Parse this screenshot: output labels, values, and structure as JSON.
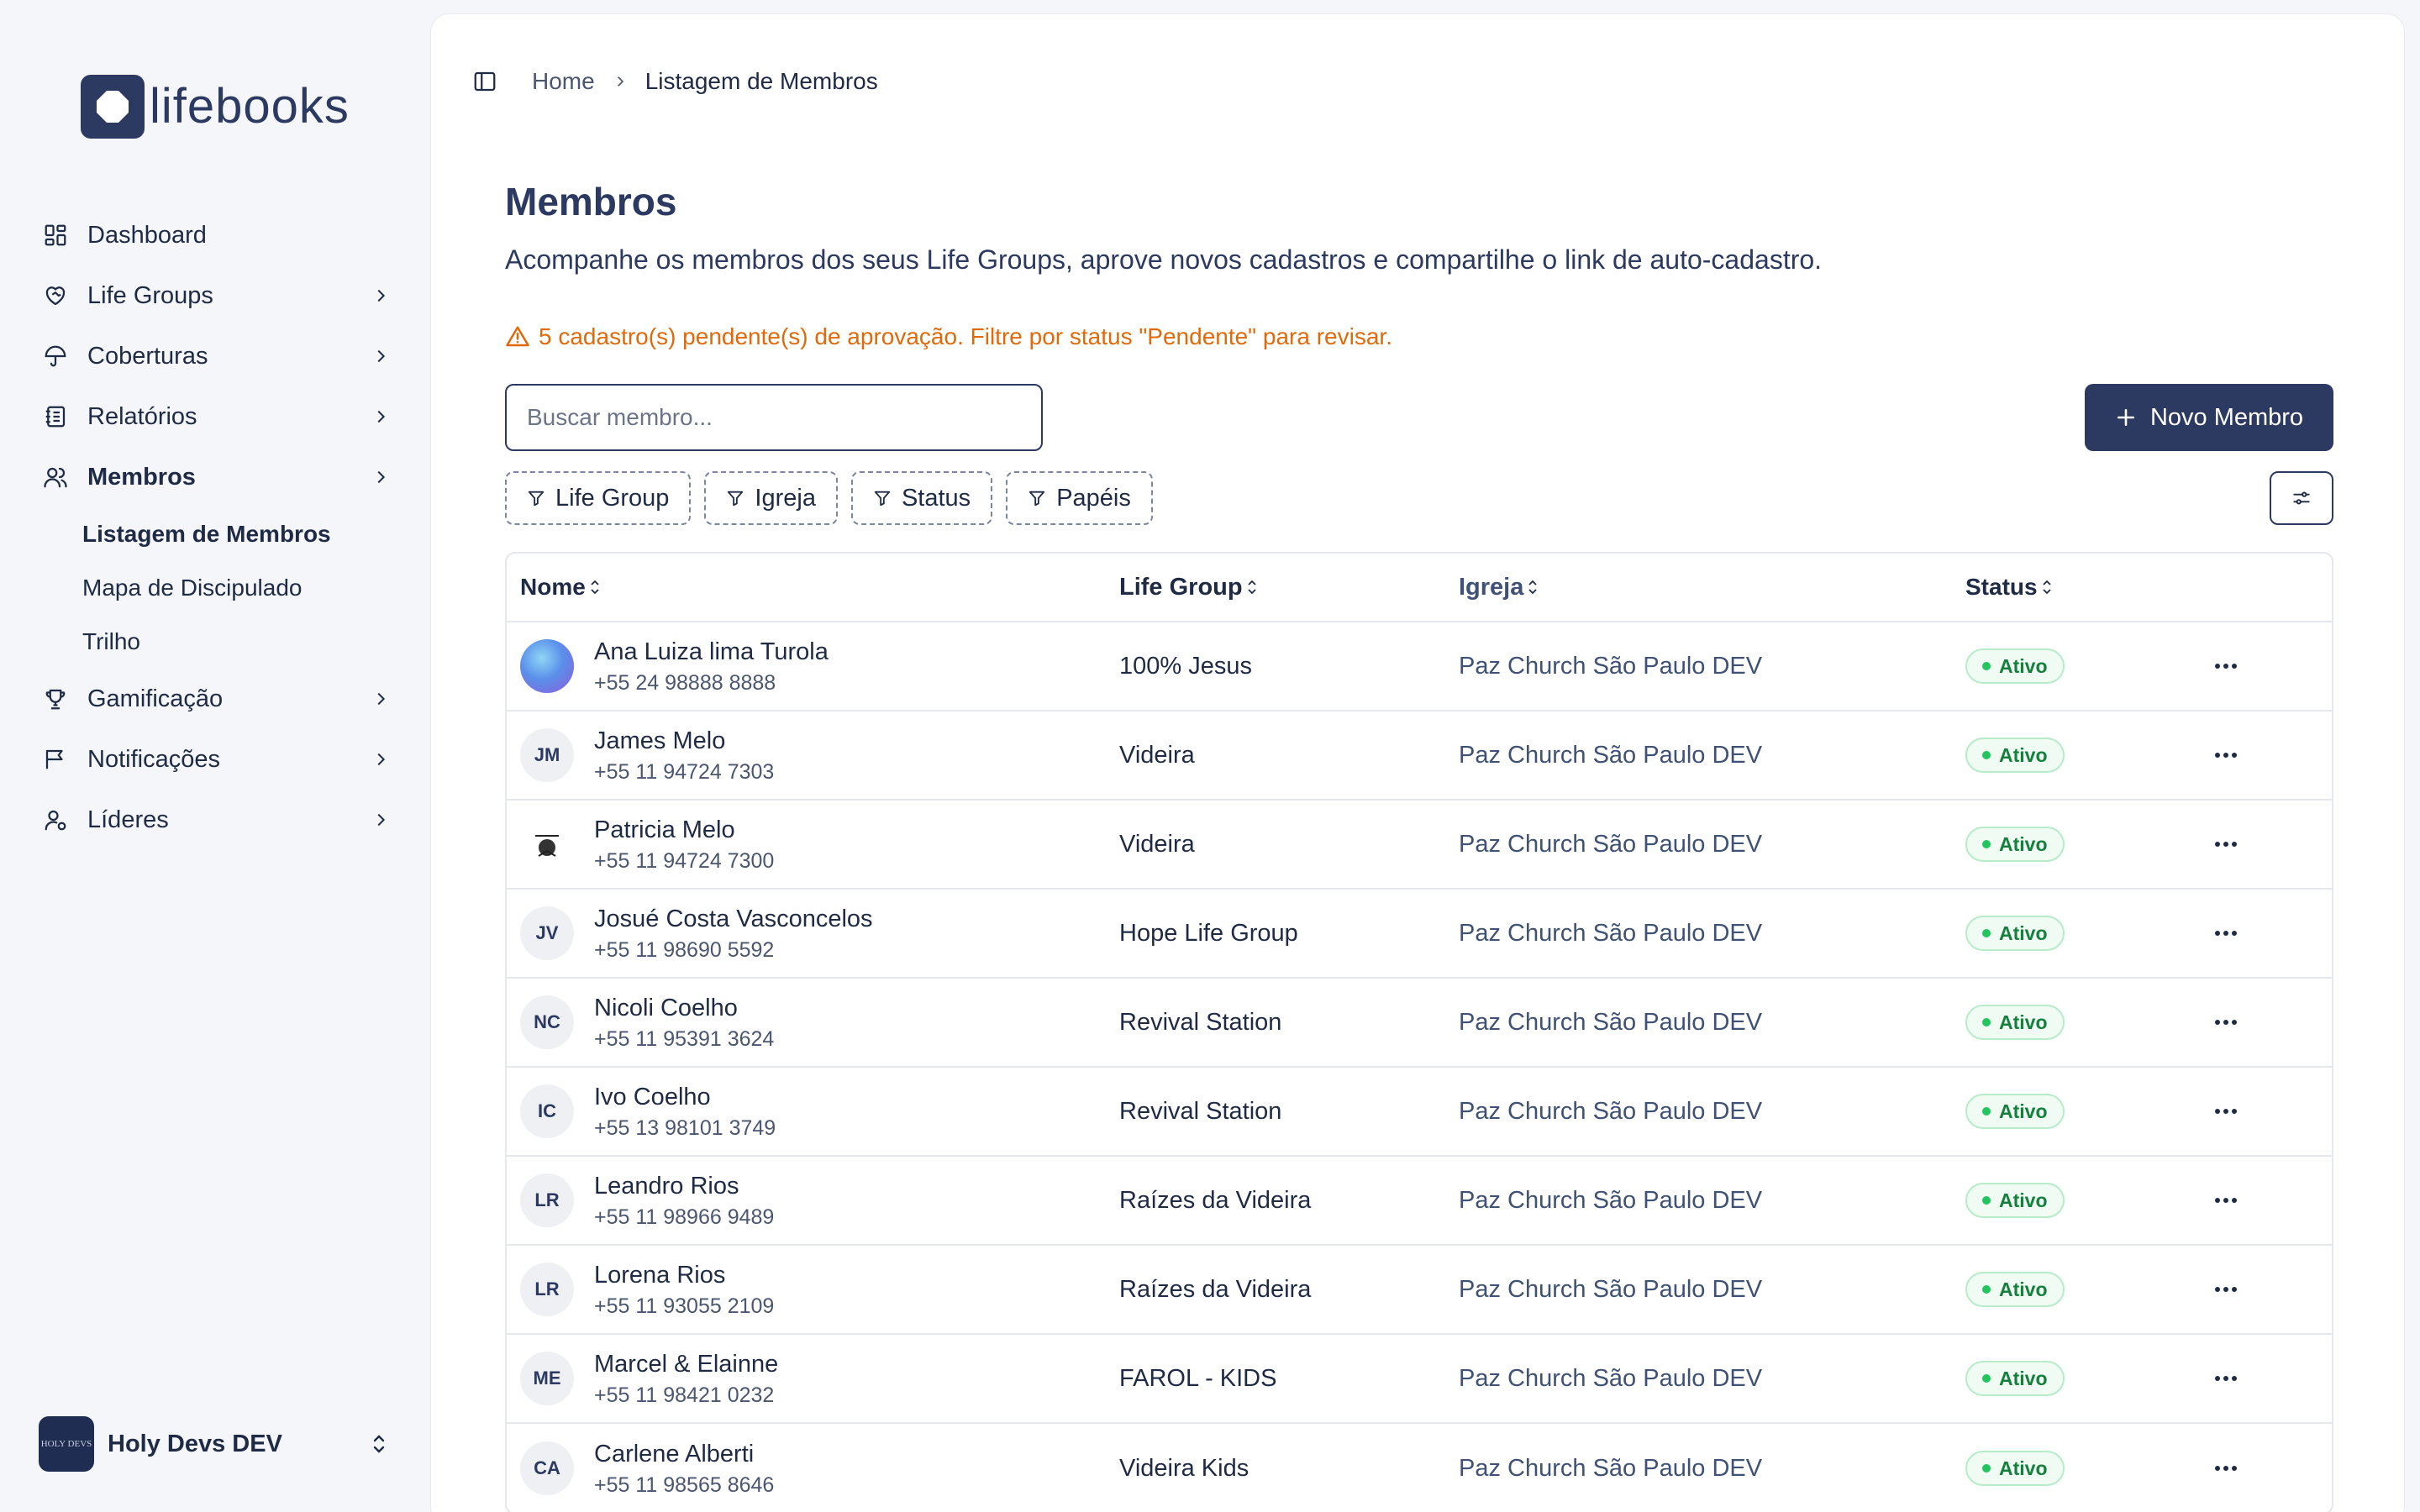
{
  "app": {
    "logo_text": "lifebooks"
  },
  "sidebar": {
    "items": [
      {
        "label": "Dashboard",
        "icon": "dashboard-icon",
        "chevron": false
      },
      {
        "label": "Life Groups",
        "icon": "heart-handshake-icon",
        "chevron": true
      },
      {
        "label": "Coberturas",
        "icon": "umbrella-icon",
        "chevron": true
      },
      {
        "label": "Relatórios",
        "icon": "notebook-icon",
        "chevron": true
      },
      {
        "label": "Membros",
        "icon": "users-icon",
        "chevron": true,
        "active": true
      },
      {
        "label": "Gamificação",
        "icon": "trophy-icon",
        "chevron": true
      },
      {
        "label": "Notificações",
        "icon": "message-flag-icon",
        "chevron": true
      },
      {
        "label": "Líderes",
        "icon": "user-cog-icon",
        "chevron": true
      }
    ],
    "subitems": [
      {
        "label": "Listagem de Membros",
        "active": true
      },
      {
        "label": "Mapa de Discipulado"
      },
      {
        "label": "Trilho"
      }
    ],
    "org": {
      "name": "Holy Devs DEV",
      "avatar_text": "HOLY DEVS"
    }
  },
  "breadcrumb": {
    "home": "Home",
    "current": "Listagem de Membros"
  },
  "page": {
    "title": "Membros",
    "description": "Acompanhe os membros dos seus Life Groups, aprove novos cadastros e compartilhe o link de auto-cadastro.",
    "alert": "5 cadastro(s) pendente(s) de aprovação. Filtre por status \"Pendente\" para revisar."
  },
  "toolbar": {
    "search_placeholder": "Buscar membro...",
    "new_button": "Novo Membro",
    "filters": [
      "Life Group",
      "Igreja",
      "Status",
      "Papéis"
    ]
  },
  "table": {
    "columns": [
      "Nome",
      "Life Group",
      "Igreja",
      "Status"
    ],
    "rows": [
      {
        "name": "Ana Luiza lima Turola",
        "phone": "+55 24 98888 8888",
        "life_group": "100% Jesus",
        "church": "Paz Church São Paulo DEV",
        "status": "Ativo",
        "initials": "",
        "avatar": "photo-gradient"
      },
      {
        "name": "James Melo",
        "phone": "+55 11 94724 7303",
        "life_group": "Videira",
        "church": "Paz Church São Paulo DEV",
        "status": "Ativo",
        "initials": "JM",
        "avatar": "initials"
      },
      {
        "name": "Patricia Melo",
        "phone": "+55 11 94724 7300",
        "life_group": "Videira",
        "church": "Paz Church São Paulo DEV",
        "status": "Ativo",
        "initials": "",
        "avatar": "photo-logo"
      },
      {
        "name": "Josué Costa Vasconcelos",
        "phone": "+55 11 98690 5592",
        "life_group": "Hope Life Group",
        "church": "Paz Church São Paulo DEV",
        "status": "Ativo",
        "initials": "JV",
        "avatar": "initials"
      },
      {
        "name": "Nicoli Coelho",
        "phone": "+55 11 95391 3624",
        "life_group": "Revival Station",
        "church": "Paz Church São Paulo DEV",
        "status": "Ativo",
        "initials": "NC",
        "avatar": "initials"
      },
      {
        "name": "Ivo Coelho",
        "phone": "+55 13 98101 3749",
        "life_group": "Revival Station",
        "church": "Paz Church São Paulo DEV",
        "status": "Ativo",
        "initials": "IC",
        "avatar": "initials"
      },
      {
        "name": "Leandro Rios",
        "phone": "+55 11 98966 9489",
        "life_group": "Raízes da Videira",
        "church": "Paz Church São Paulo DEV",
        "status": "Ativo",
        "initials": "LR",
        "avatar": "initials"
      },
      {
        "name": "Lorena Rios",
        "phone": "+55 11 93055 2109",
        "life_group": "Raízes da Videira",
        "church": "Paz Church São Paulo DEV",
        "status": "Ativo",
        "initials": "LR",
        "avatar": "initials"
      },
      {
        "name": "Marcel & Elainne",
        "phone": "+55 11 98421 0232",
        "life_group": "FAROL - KIDS",
        "church": "Paz Church São Paulo DEV",
        "status": "Ativo",
        "initials": "ME",
        "avatar": "initials"
      },
      {
        "name": "Carlene Alberti",
        "phone": "+55 11 98565 8646",
        "life_group": "Videira Kids",
        "church": "Paz Church São Paulo DEV",
        "status": "Ativo",
        "initials": "CA",
        "avatar": "initials"
      }
    ]
  },
  "colors": {
    "brand": "#2c3a61",
    "alert": "#e06a0b",
    "status_active": "#15803d",
    "background": "#f4f6f9"
  }
}
